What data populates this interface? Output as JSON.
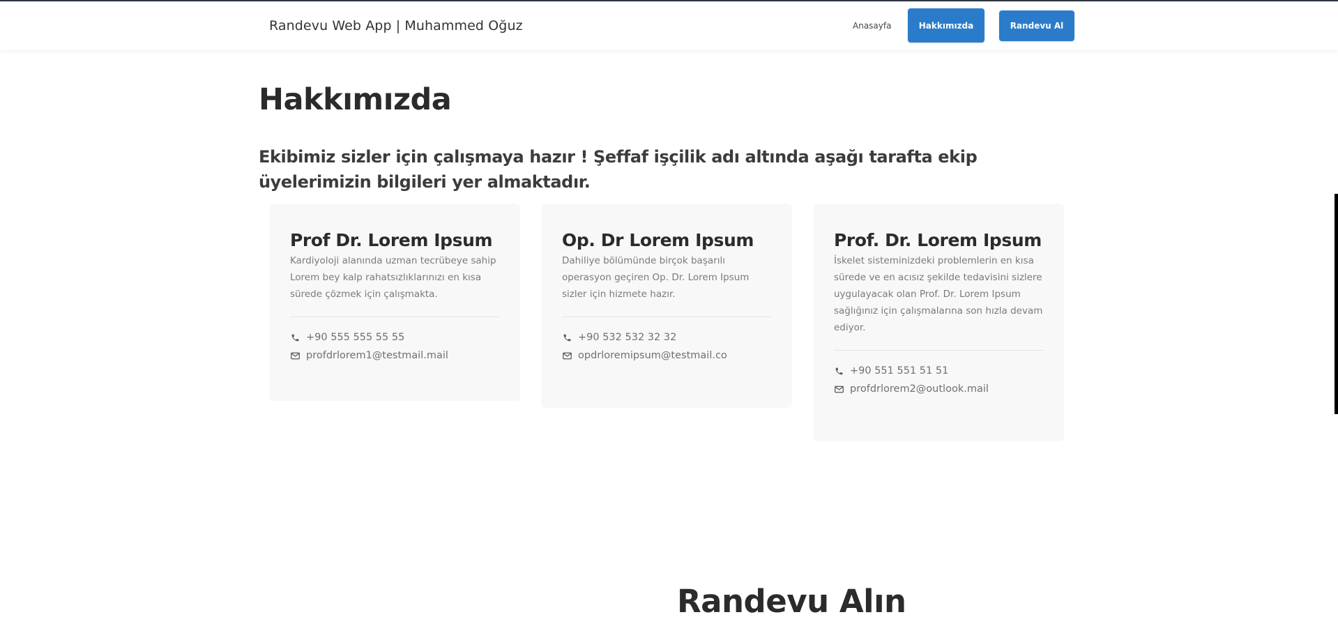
{
  "header": {
    "brand": "Randevu Web App | Muhammed Oğuz",
    "nav_home": "Anasayfa",
    "nav_about": "Hakkımızda",
    "nav_appointment": "Randevu Al"
  },
  "about": {
    "title": "Hakkımızda",
    "intro": "Ekibimiz sizler için çalışmaya hazır ! Şeffaf işçilik adı altında aşağı tarafta ekip üyelerimizin bilgileri yer almaktadır."
  },
  "doctors": [
    {
      "name": "Prof Dr. Lorem Ipsum",
      "description": "Kardiyoloji alanında uzman tecrübeye sahip Lorem bey kalp rahatsızlıklarınızı en kısa sürede çözmek için çalışmakta.",
      "phone": "+90 555 555 55 55",
      "email": "profdrlorem1@testmail.mail"
    },
    {
      "name": "Op. Dr Lorem Ipsum",
      "description": "Dahiliye bölümünde birçok başarılı operasyon geçiren Op. Dr. Lorem Ipsum sizler için hizmete hazır.",
      "phone": "+90 532 532 32 32",
      "email": "opdrloremipsum@testmail.co"
    },
    {
      "name": "Prof. Dr. Lorem Ipsum",
      "description": "İskelet sisteminizdeki problemlerin en kısa sürede ve en acısız şekilde tedavisini sizlere uygulayacak olan Prof. Dr. Lorem Ipsum sağlığınız için çalışmalarına son hızla devam ediyor.",
      "phone": "+90 551 551 51 51",
      "email": "profdrlorem2@outlook.mail"
    }
  ],
  "appointment": {
    "title": "Randevu Alın"
  },
  "icons": {
    "phone": "phone-icon",
    "email": "envelope-icon"
  },
  "colors": {
    "accent": "#2a7ccb",
    "card_background": "#f8f8f8",
    "heading": "#2b2b2b",
    "muted_text": "#7a7a7a"
  }
}
